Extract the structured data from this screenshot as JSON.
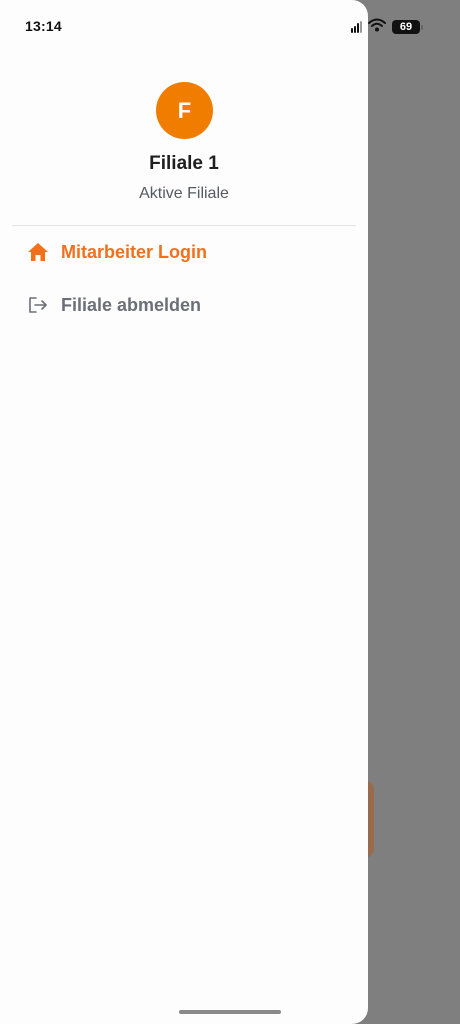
{
  "status_bar": {
    "time": "13:14",
    "battery": "69",
    "icons": [
      "signal-icon",
      "wifi-icon",
      "battery-icon"
    ]
  },
  "profile": {
    "initial": "F",
    "name": "Filiale 1",
    "subtitle": "Aktive Filiale",
    "avatar_color": "#f07c00"
  },
  "menu": {
    "items": [
      {
        "label": "Mitarbeiter Login",
        "icon": "home-icon",
        "active": true,
        "color": "#f0701e"
      },
      {
        "label": "Filiale abmelden",
        "icon": "logout-icon",
        "active": false,
        "color": "#6b7078"
      }
    ]
  }
}
